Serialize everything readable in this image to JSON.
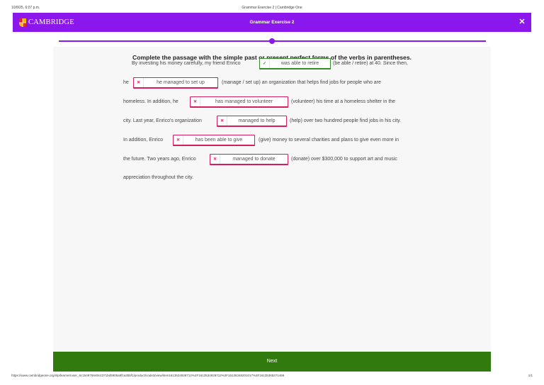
{
  "print": {
    "date": "10/8/25, 6:07 p.m.",
    "title": "Grammar Exercise 2 | Cambridge One",
    "url": "https://www.cambridgeone.org/nlp/learner/user_6c154976649c4371bd5905a9f1a35bf1/product/code3/view/item1613534928712%2F1613534928712%2F16135346201017%2F16135365271466",
    "page": "1/1"
  },
  "header": {
    "brand": "CAMBRIDGE",
    "title": "Grammar Exercise 2",
    "close_symbol": "✕",
    "accent": "#8b17ec"
  },
  "exercise": {
    "instruction": "Complete the passage with the simple past or present perfect forms of the verbs in parentheses.",
    "lines": [
      {
        "before": "By investing his money carefully, my friend Enrico",
        "after": "(be able / retire) at 40. Since then,"
      },
      {
        "before": "he",
        "after": "(manage / set up) an organization that helps find jobs for people who are"
      },
      {
        "before": "homeless. In addition, he",
        "after": "(volunteer) his time at a homeless shelter in the"
      },
      {
        "before": "city. Last year, Enrico's organization",
        "after": "(help) over two hundred people find jobs in his city."
      },
      {
        "before": "In addition, Enrico",
        "after": "(give) money to several charities and plans to give even more in"
      },
      {
        "before": "the future. Two years ago, Enrico",
        "after": "(donate) over $300,000 to support art and music"
      },
      {
        "before": "appreciation throughout the city.",
        "after": ""
      }
    ],
    "answers": [
      {
        "value": "was able to retire",
        "status": "correct",
        "icon": "check-icon",
        "symbol": "✓"
      },
      {
        "value": "he managed to set up",
        "status": "incorrect",
        "icon": "cross-icon",
        "symbol": "✕"
      },
      {
        "value": "has managed to volunteer",
        "status": "incorrect",
        "icon": "cross-icon",
        "symbol": "✕"
      },
      {
        "value": "managed to help",
        "status": "incorrect",
        "icon": "cross-icon",
        "symbol": "✕"
      },
      {
        "value": "has been able to give",
        "status": "incorrect",
        "icon": "cross-icon",
        "symbol": "✕"
      },
      {
        "value": "managed to donate",
        "status": "incorrect",
        "icon": "cross-icon",
        "symbol": "✕"
      }
    ],
    "colors": {
      "correct": "#3a8a2e",
      "incorrect": "#d51f5a"
    }
  },
  "footer": {
    "next_label": "Next",
    "next_color": "#317a0d"
  }
}
